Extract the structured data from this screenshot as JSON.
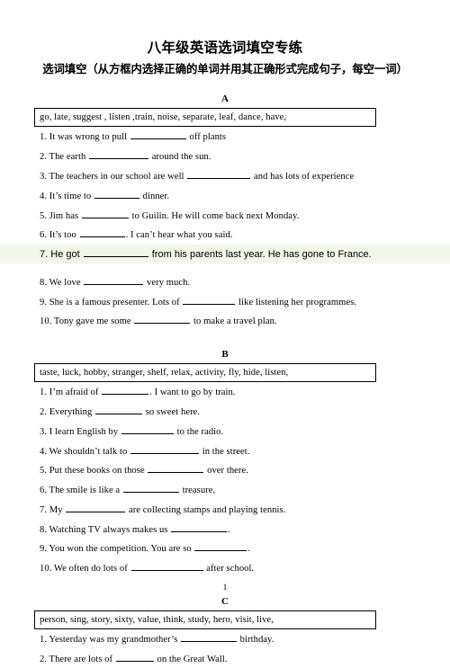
{
  "document": {
    "title": "八年级英语选词填空专练",
    "subtitle": "选词填空（从方框内选择正确的单词并用其正确形式完成句子，每空一词）",
    "page_number": "1"
  },
  "sections": [
    {
      "letter": "A",
      "word_bank": "go, late, suggest , listen ,train, noise, separate, leaf, dance,   have,",
      "questions": [
        {
          "num": "1.",
          "before": "  It was wrong to pull",
          "blank_width": 62,
          "after": "off plants",
          "highlighted": false
        },
        {
          "num": "2.",
          "before": "The earth",
          "blank_width": 66,
          "after": "around the sun.",
          "highlighted": false
        },
        {
          "num": "3.",
          "before": "The teachers in our school are well",
          "blank_width": 70,
          "after": "and has lots of experience",
          "highlighted": false
        },
        {
          "num": "4.",
          "before": "It’s time to",
          "blank_width": 50,
          "after": "dinner.",
          "highlighted": false
        },
        {
          "num": "5.",
          "before": "Jim has",
          "blank_width": 52,
          "after": "to Guilin. He will come back next Monday.",
          "highlighted": false
        },
        {
          "num": "6.",
          "before": "It’s too",
          "blank_width": 50,
          "after": ". I can’t hear what you said.",
          "highlighted": false
        },
        {
          "num": "7.",
          "before": "He got",
          "blank_width": 72,
          "after": "from his parents last year. He has gone to France.",
          "highlighted": true
        },
        {
          "num": "8.",
          "before": "We love",
          "blank_width": 66,
          "after": "very much.",
          "highlighted": false
        },
        {
          "num": "9.",
          "before": "She is a famous presenter. Lots of",
          "blank_width": 58,
          "after": "like listening her programmes.",
          "highlighted": false
        },
        {
          "num": "10.",
          "before": "Tony gave me some",
          "blank_width": 62,
          "after": "to make a travel plan.",
          "highlighted": false
        }
      ]
    },
    {
      "letter": "B",
      "word_bank": "taste, luck, hobby, stranger, shelf, relax, activity, fly, hide, listen,",
      "questions": [
        {
          "num": "1.",
          "before": "  I’m afraid of",
          "blank_width": 52,
          "after": ". I want to go by train.",
          "highlighted": false
        },
        {
          "num": "2.",
          "before": "Everything",
          "blank_width": 52,
          "after": "so sweet here.",
          "highlighted": false
        },
        {
          "num": "3.",
          "before": "I learn English by",
          "blank_width": 58,
          "after": "to the radio.",
          "highlighted": false
        },
        {
          "num": "4.",
          "before": "We shouldn’t talk to",
          "blank_width": 76,
          "after": "in the street.",
          "highlighted": false
        },
        {
          "num": "5.",
          "before": "Put these books on those",
          "blank_width": 62,
          "after": "over there.",
          "highlighted": false
        },
        {
          "num": "6.",
          "before": "The smile is like a",
          "blank_width": 62,
          "after": "treasure.",
          "highlighted": false
        },
        {
          "num": "7.",
          "before": "My",
          "blank_width": 66,
          "after": "are collecting stamps and playing tennis.",
          "highlighted": false
        },
        {
          "num": "8.",
          "before": "Watching TV always makes us",
          "blank_width": 62,
          "after": ".",
          "highlighted": false
        },
        {
          "num": "9.",
          "before": "You won the competition. You are so",
          "blank_width": 58,
          "after": ".",
          "highlighted": false
        },
        {
          "num": "10.",
          "before": "We often do lots of",
          "blank_width": 80,
          "after": "after school.",
          "highlighted": false
        }
      ]
    },
    {
      "letter": "C",
      "word_bank": "person, sing, story, sixty, value, think, study, hero, visit, live,",
      "questions": [
        {
          "num": "1.",
          "before": "Yesterday was my grandmother’s",
          "blank_width": 62,
          "after": "birthday.",
          "highlighted": false
        },
        {
          "num": "2.",
          "before": "There are lots of",
          "blank_width": 42,
          "after": "on the Great Wall.",
          "highlighted": false
        }
      ]
    }
  ]
}
